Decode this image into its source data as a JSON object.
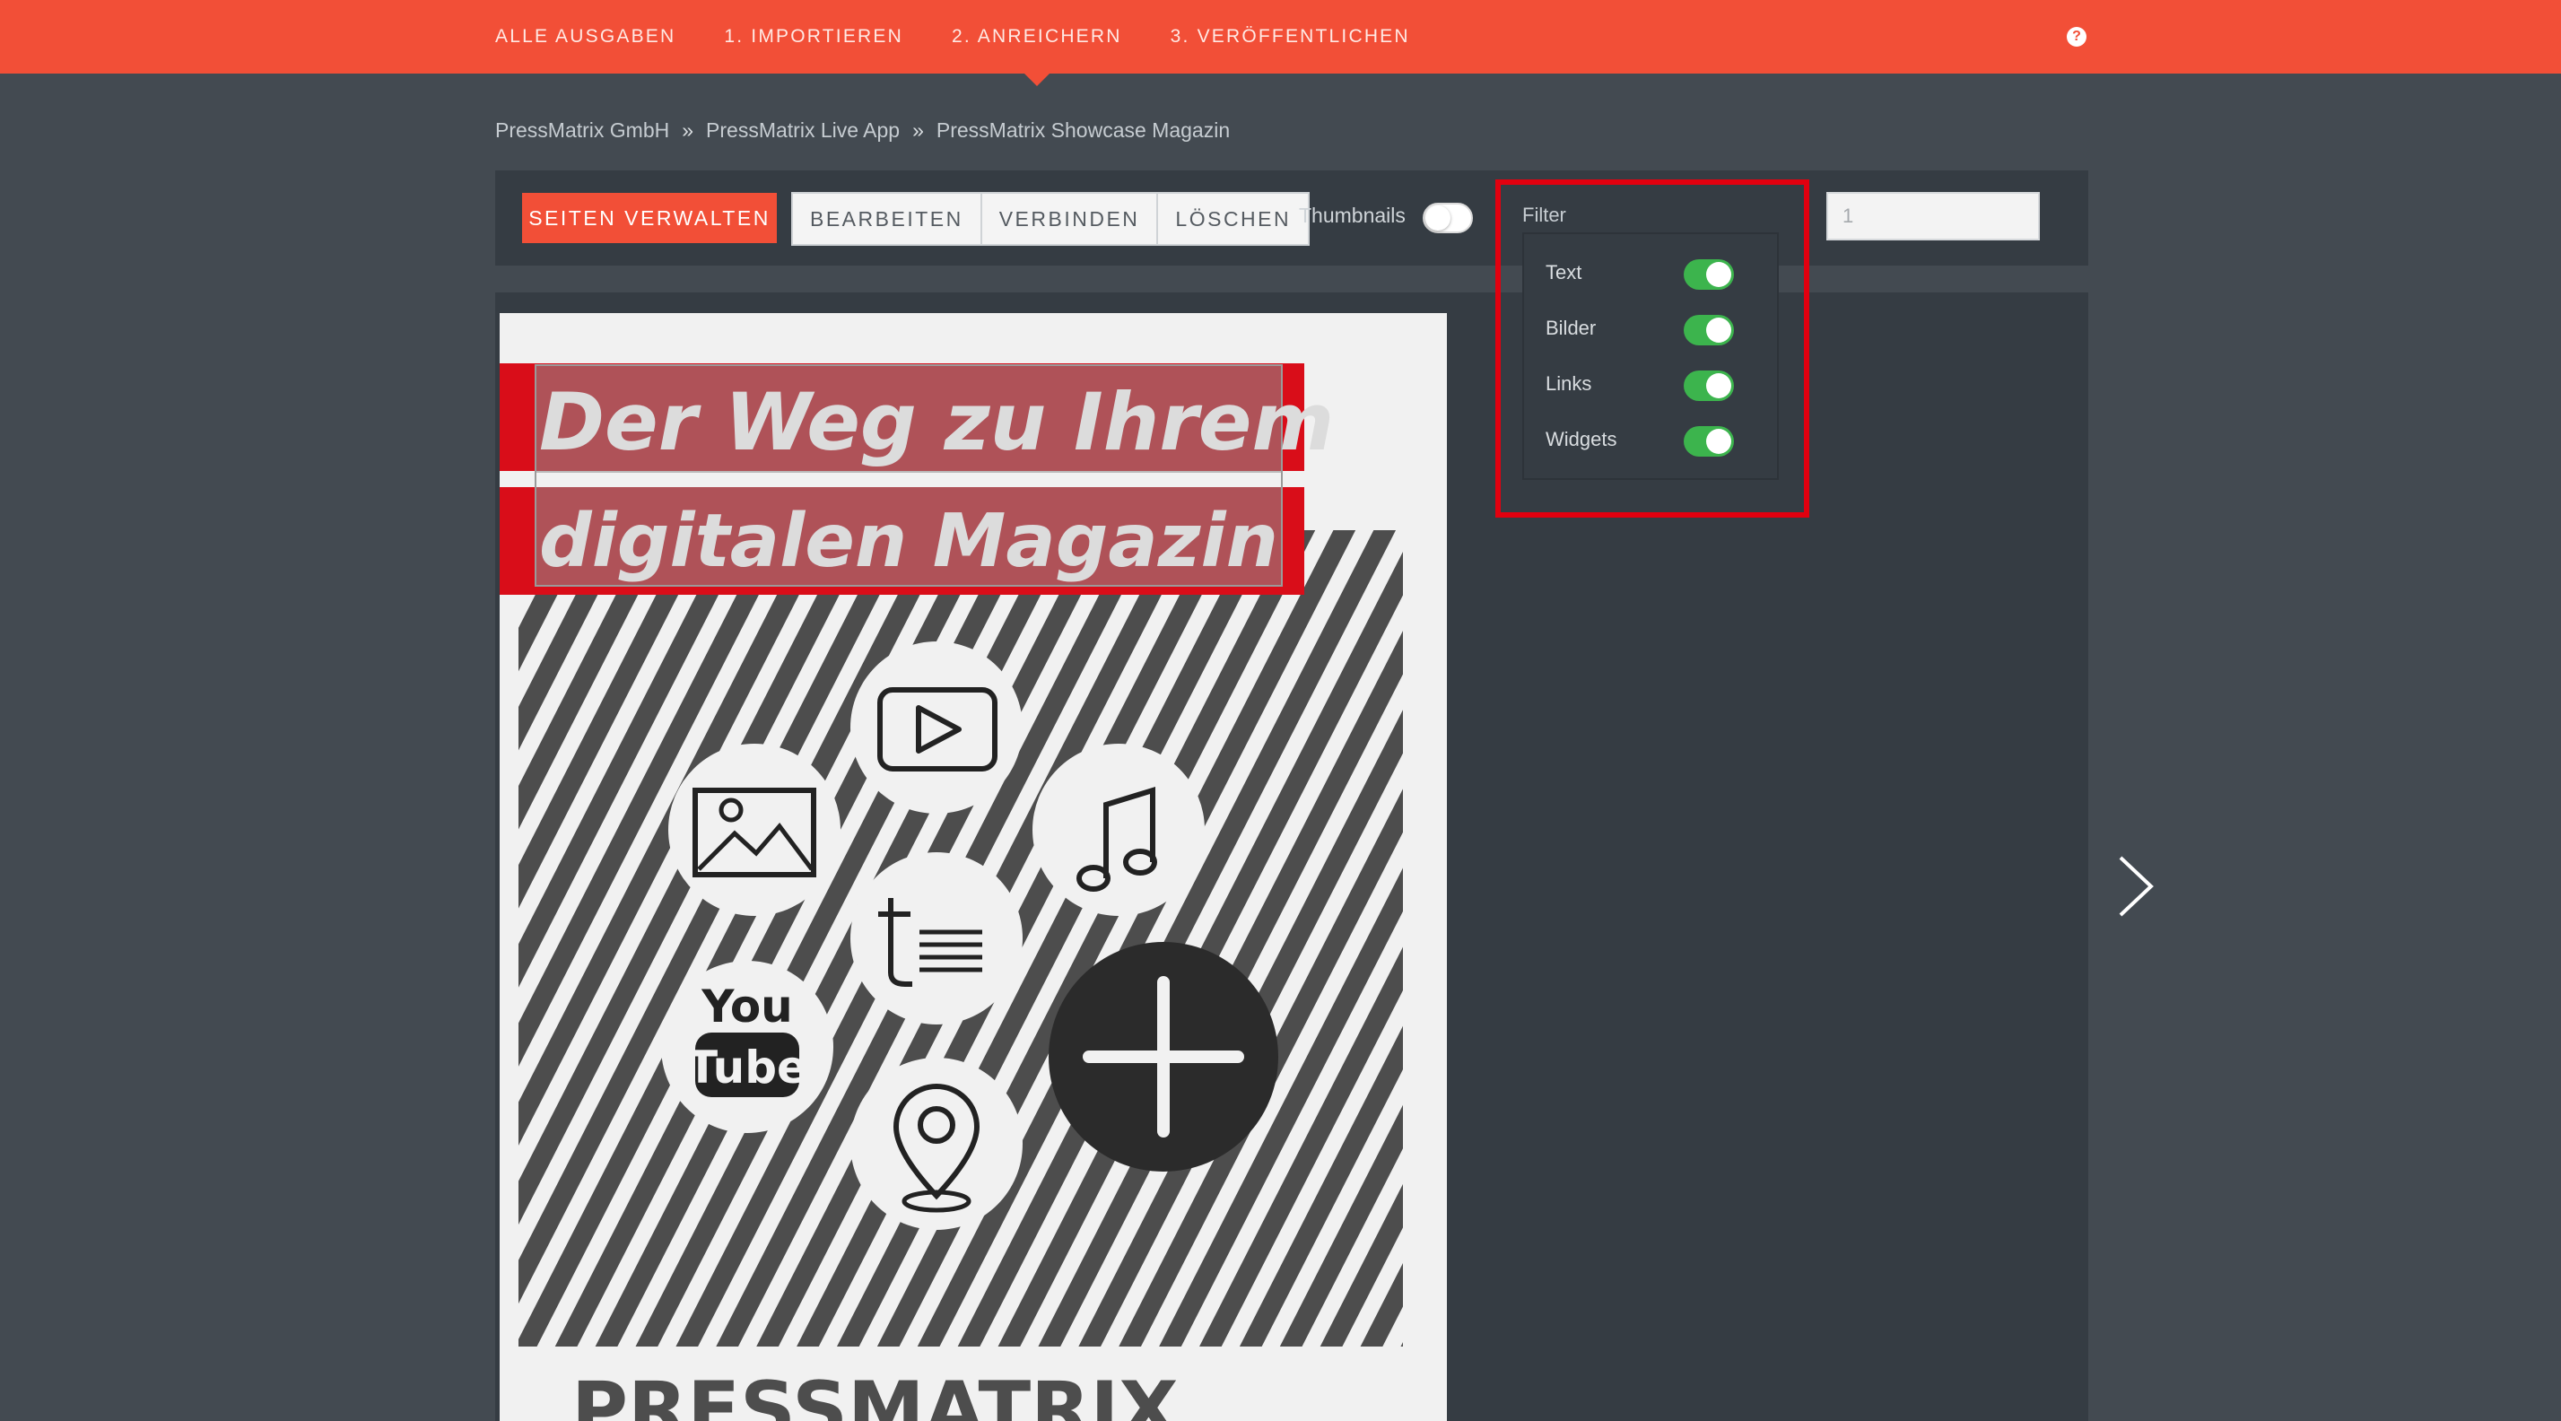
{
  "nav": {
    "items": [
      "ALLE AUSGABEN",
      "1. IMPORTIEREN",
      "2. ANREICHERN",
      "3. VERÖFFENTLICHEN"
    ],
    "active_index": 2,
    "help_glyph": "?"
  },
  "breadcrumb": [
    "PressMatrix GmbH",
    "PressMatrix Live App",
    "PressMatrix Showcase Magazin"
  ],
  "breadcrumb_separator": "»",
  "toolbar": {
    "manage_pages_label": "SEITEN VERWALTEN",
    "edit_label": "BEARBEITEN",
    "connect_label": "VERBINDEN",
    "delete_label": "LÖSCHEN",
    "thumbnails_label": "Thumbnails",
    "thumbnails_on": false,
    "filter_label": "Filter",
    "page_number": "1"
  },
  "filter": {
    "items": [
      {
        "label": "Text",
        "on": true
      },
      {
        "label": "Bilder",
        "on": true
      },
      {
        "label": "Links",
        "on": true
      },
      {
        "label": "Widgets",
        "on": true
      }
    ]
  },
  "page": {
    "headline_line1": "Der Weg zu Ihrem",
    "headline_line2": "digitalen Magazin",
    "footer_logo": "PRESSMATRIX"
  },
  "icons": [
    "help-icon",
    "video-play-icon",
    "image-icon",
    "music-note-icon",
    "text-icon",
    "youtube-icon",
    "add-plus-icon",
    "map-pin-icon",
    "chevron-right-icon"
  ],
  "colors": {
    "accent": "#f24f37",
    "background": "#434a51",
    "panel": "#353c43",
    "toggle_on": "#3cb44d",
    "highlight": "#e2000f",
    "magazine_red": "#d90d19"
  }
}
